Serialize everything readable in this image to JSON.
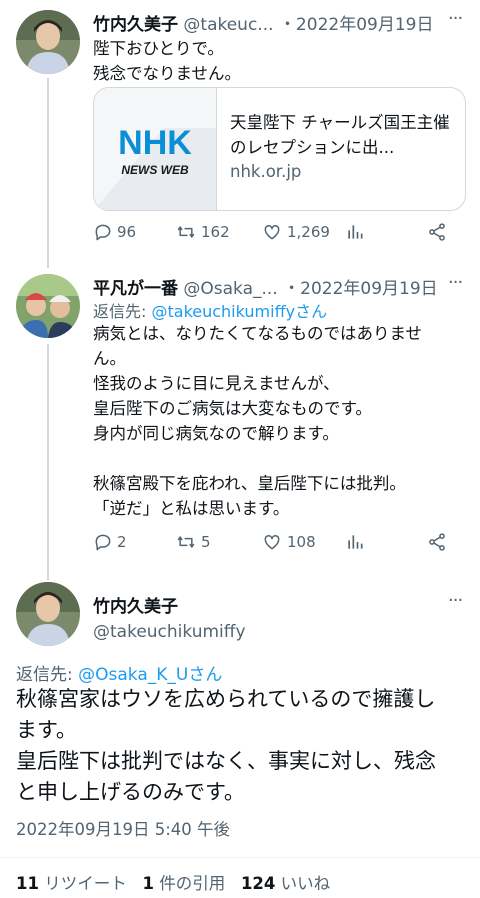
{
  "tweet1": {
    "name": "竹内久美子",
    "handle": "@takeuc...",
    "date": "・2022年09月19日",
    "lines": [
      "陛下おひとりで。",
      "残念でなりません。"
    ],
    "card": {
      "logo_text": "NHK",
      "logo_sub": "NEWS WEB",
      "title": "天皇陛下 チャールズ国王主催のレセプションに出...",
      "domain": "nhk.or.jp"
    },
    "replies": "96",
    "retweets": "162",
    "likes": "1,269"
  },
  "tweet2": {
    "name": "平凡が一番",
    "handle": "@Osaka_...",
    "date": "・2022年09月19日",
    "replying_prefix": "返信先: ",
    "replying_to": "@takeuchikumiffyさん",
    "lines": [
      "病気とは、なりたくてなるものではありませ",
      "ん。",
      "怪我のように目に見えませんが、",
      "皇后陛下のご病気は大変なものです。",
      "身内が同じ病気なので解ります。",
      "",
      "秋篠宮殿下を庇われ、皇后陛下には批判。",
      "「逆だ」と私は思います。"
    ],
    "replies": "2",
    "retweets": "5",
    "likes": "108"
  },
  "tweet3": {
    "name": "竹内久美子",
    "handle": "@takeuchikumiffy",
    "replying_prefix": "返信先: ",
    "replying_to": "@Osaka_K_Uさん",
    "lines": [
      "秋篠宮家はウソを広められているので擁護し",
      "ます。",
      "皇后陛下は批判ではなく、事実に対し、残念",
      "と申し上げるのみです。"
    ],
    "timestamp": "2022年09月19日 5:40 午後"
  },
  "stats": {
    "retweets_count": "11",
    "retweets_label": " リツイート",
    "quotes_count": "1",
    "quotes_label": " 件の引用",
    "likes_count": "124",
    "likes_label": " いいね"
  },
  "colors": {
    "accent": "#1d9bf0",
    "muted": "#536471",
    "text": "#0f1419",
    "border": "#cfd9de"
  }
}
